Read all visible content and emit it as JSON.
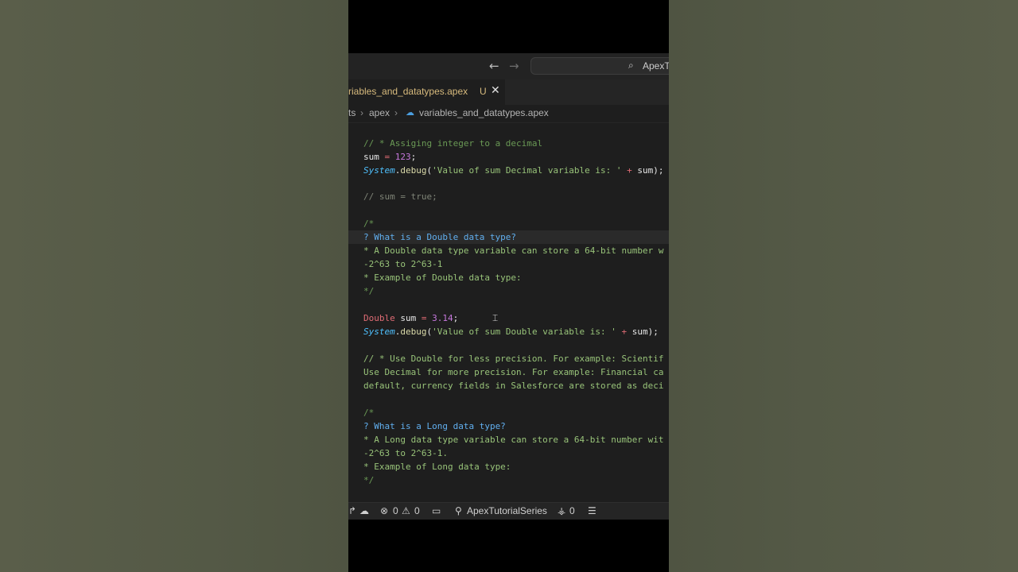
{
  "titlebar": {
    "back_icon": "arrow-left-icon",
    "forward_icon": "arrow-right-icon",
    "search_icon": "search-icon",
    "command_center_label": "ApexTutorialSeries"
  },
  "tab": {
    "label": "riables_and_datatypes.apex",
    "modified": "U",
    "close": "✕"
  },
  "breadcrumb": {
    "items": [
      "ts",
      "apex",
      "variables_and_datatypes.apex"
    ],
    "separator": "›"
  },
  "code": {
    "lines": [
      "// * Assiging integer to a decimal",
      "sum = 123;",
      "System.debug('Value of sum Decimal variable is: ' + sum);",
      "// sum = true;",
      "/*",
      "? What is a Double data type?",
      "* A Double data type variable can store a 64-bit number w",
      "-2^63 to 2^63-1",
      "* Example of Double data type:",
      "*/",
      "Double sum = 3.14;",
      "System.debug('Value of sum Double variable is: ' + sum);",
      "// * Use Double for less precision. For example: Scientif",
      "Use Decimal for more precision. For example: Financial ca",
      "default, currency fields in Salesforce are stored as deci",
      "/*",
      "? What is a Long data type?",
      "* A Long data type variable can store a 64-bit number wit",
      "-2^63 to 2^63-1.",
      "* Example of Long data type:",
      "*/"
    ]
  },
  "statusbar": {
    "errors": "0",
    "warnings": "0",
    "project": "ApexTutorialSeries",
    "ports": "0"
  },
  "colors": {
    "editor_bg": "#1e1e1e",
    "comment_green": "#6a9955",
    "keyword_red": "#e06c75",
    "number_purple": "#c678dd",
    "question_blue": "#61afef"
  }
}
